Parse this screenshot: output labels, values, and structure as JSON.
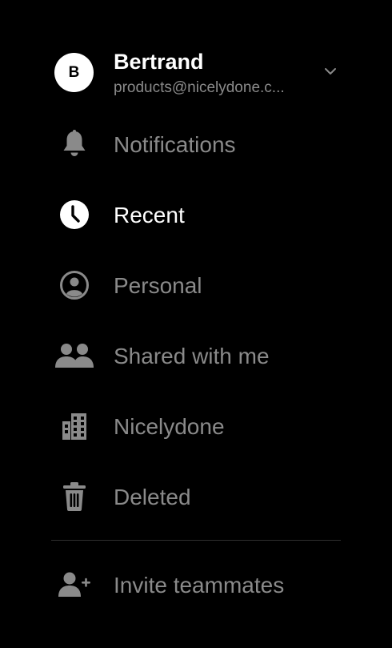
{
  "account": {
    "avatar_initial": "B",
    "name": "Bertrand",
    "email": "products@nicelydone.c..."
  },
  "nav": {
    "notifications": "Notifications",
    "recent": "Recent",
    "personal": "Personal",
    "shared": "Shared with me",
    "org": "Nicelydone",
    "deleted": "Deleted"
  },
  "footer": {
    "invite": "Invite teammates"
  },
  "colors": {
    "background": "#000000",
    "active_text": "#ffffff",
    "inactive_text": "#8a8a8a",
    "divider": "#2e2e2e"
  },
  "active_item": "recent"
}
